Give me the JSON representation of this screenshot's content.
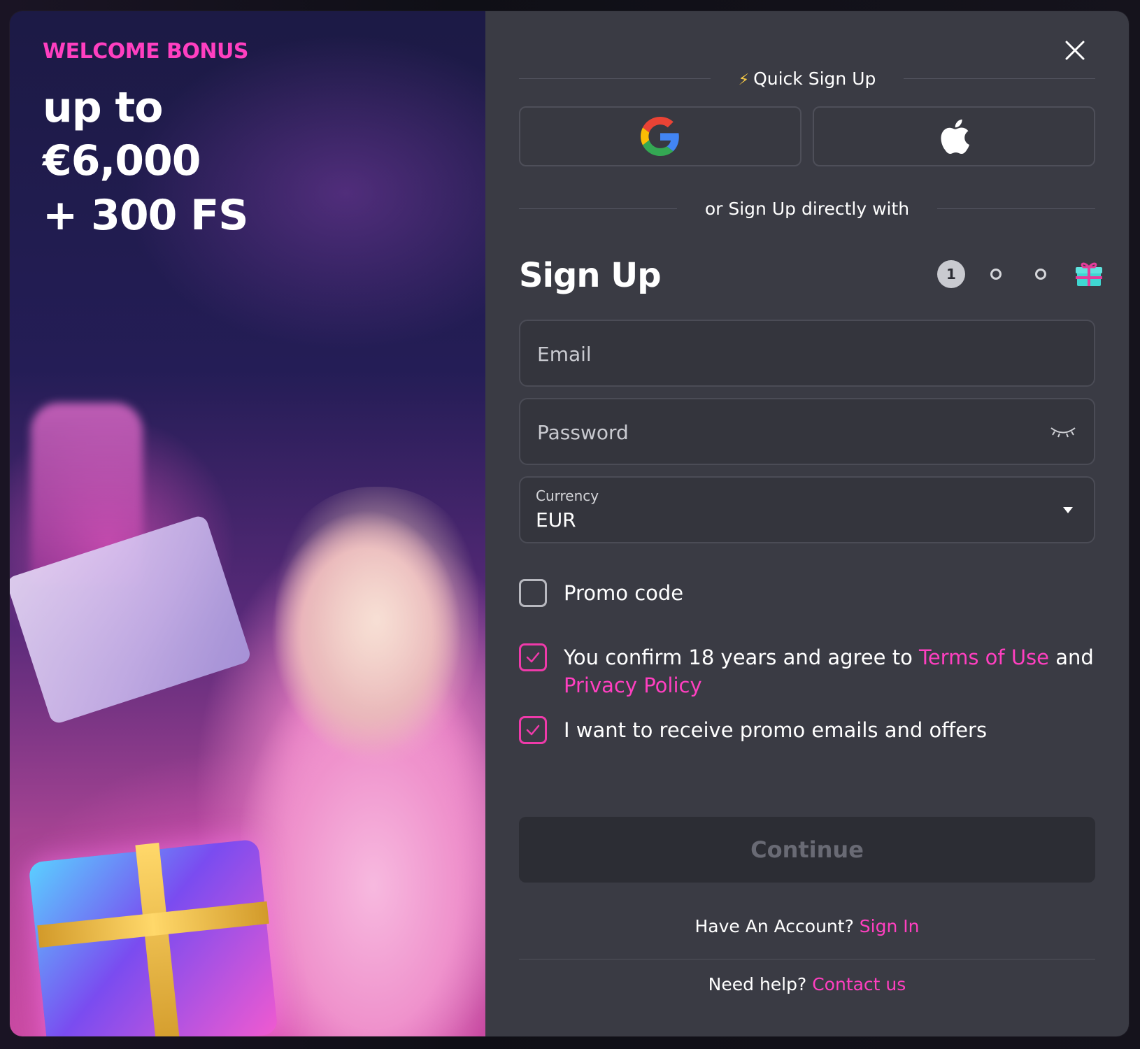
{
  "promo": {
    "label": "WELCOME BONUS",
    "line1": "up to",
    "line2": "€6,000",
    "line3": "+ 300 FS"
  },
  "quick_signup": {
    "label": "Quick Sign Up",
    "google_icon": "google-icon",
    "apple_icon": "apple-icon"
  },
  "direct": {
    "label": "or Sign Up directly with"
  },
  "signup": {
    "title": "Sign Up",
    "current_step": "1",
    "step_count": 3
  },
  "fields": {
    "email_placeholder": "Email",
    "password_placeholder": "Password",
    "currency_label": "Currency",
    "currency_value": "EUR"
  },
  "checks": {
    "promo_code": "Promo code",
    "terms_prefix": "You confirm 18 years and agree to ",
    "terms_link": "Terms of Use",
    "terms_and": " and ",
    "privacy_link": "Privacy Policy",
    "promo_emails": "I want to receive promo emails and offers",
    "promo_code_checked": false,
    "terms_checked": true,
    "promo_emails_checked": true
  },
  "actions": {
    "continue_label": "Continue",
    "have_account": "Have An Account?",
    "sign_in": "Sign In",
    "need_help": "Need help?",
    "contact_us": "Contact us"
  },
  "colors": {
    "accent_pink": "#ff3fc0",
    "panel_bg": "#3a3b44",
    "gift_teal": "#3fd6d1"
  }
}
